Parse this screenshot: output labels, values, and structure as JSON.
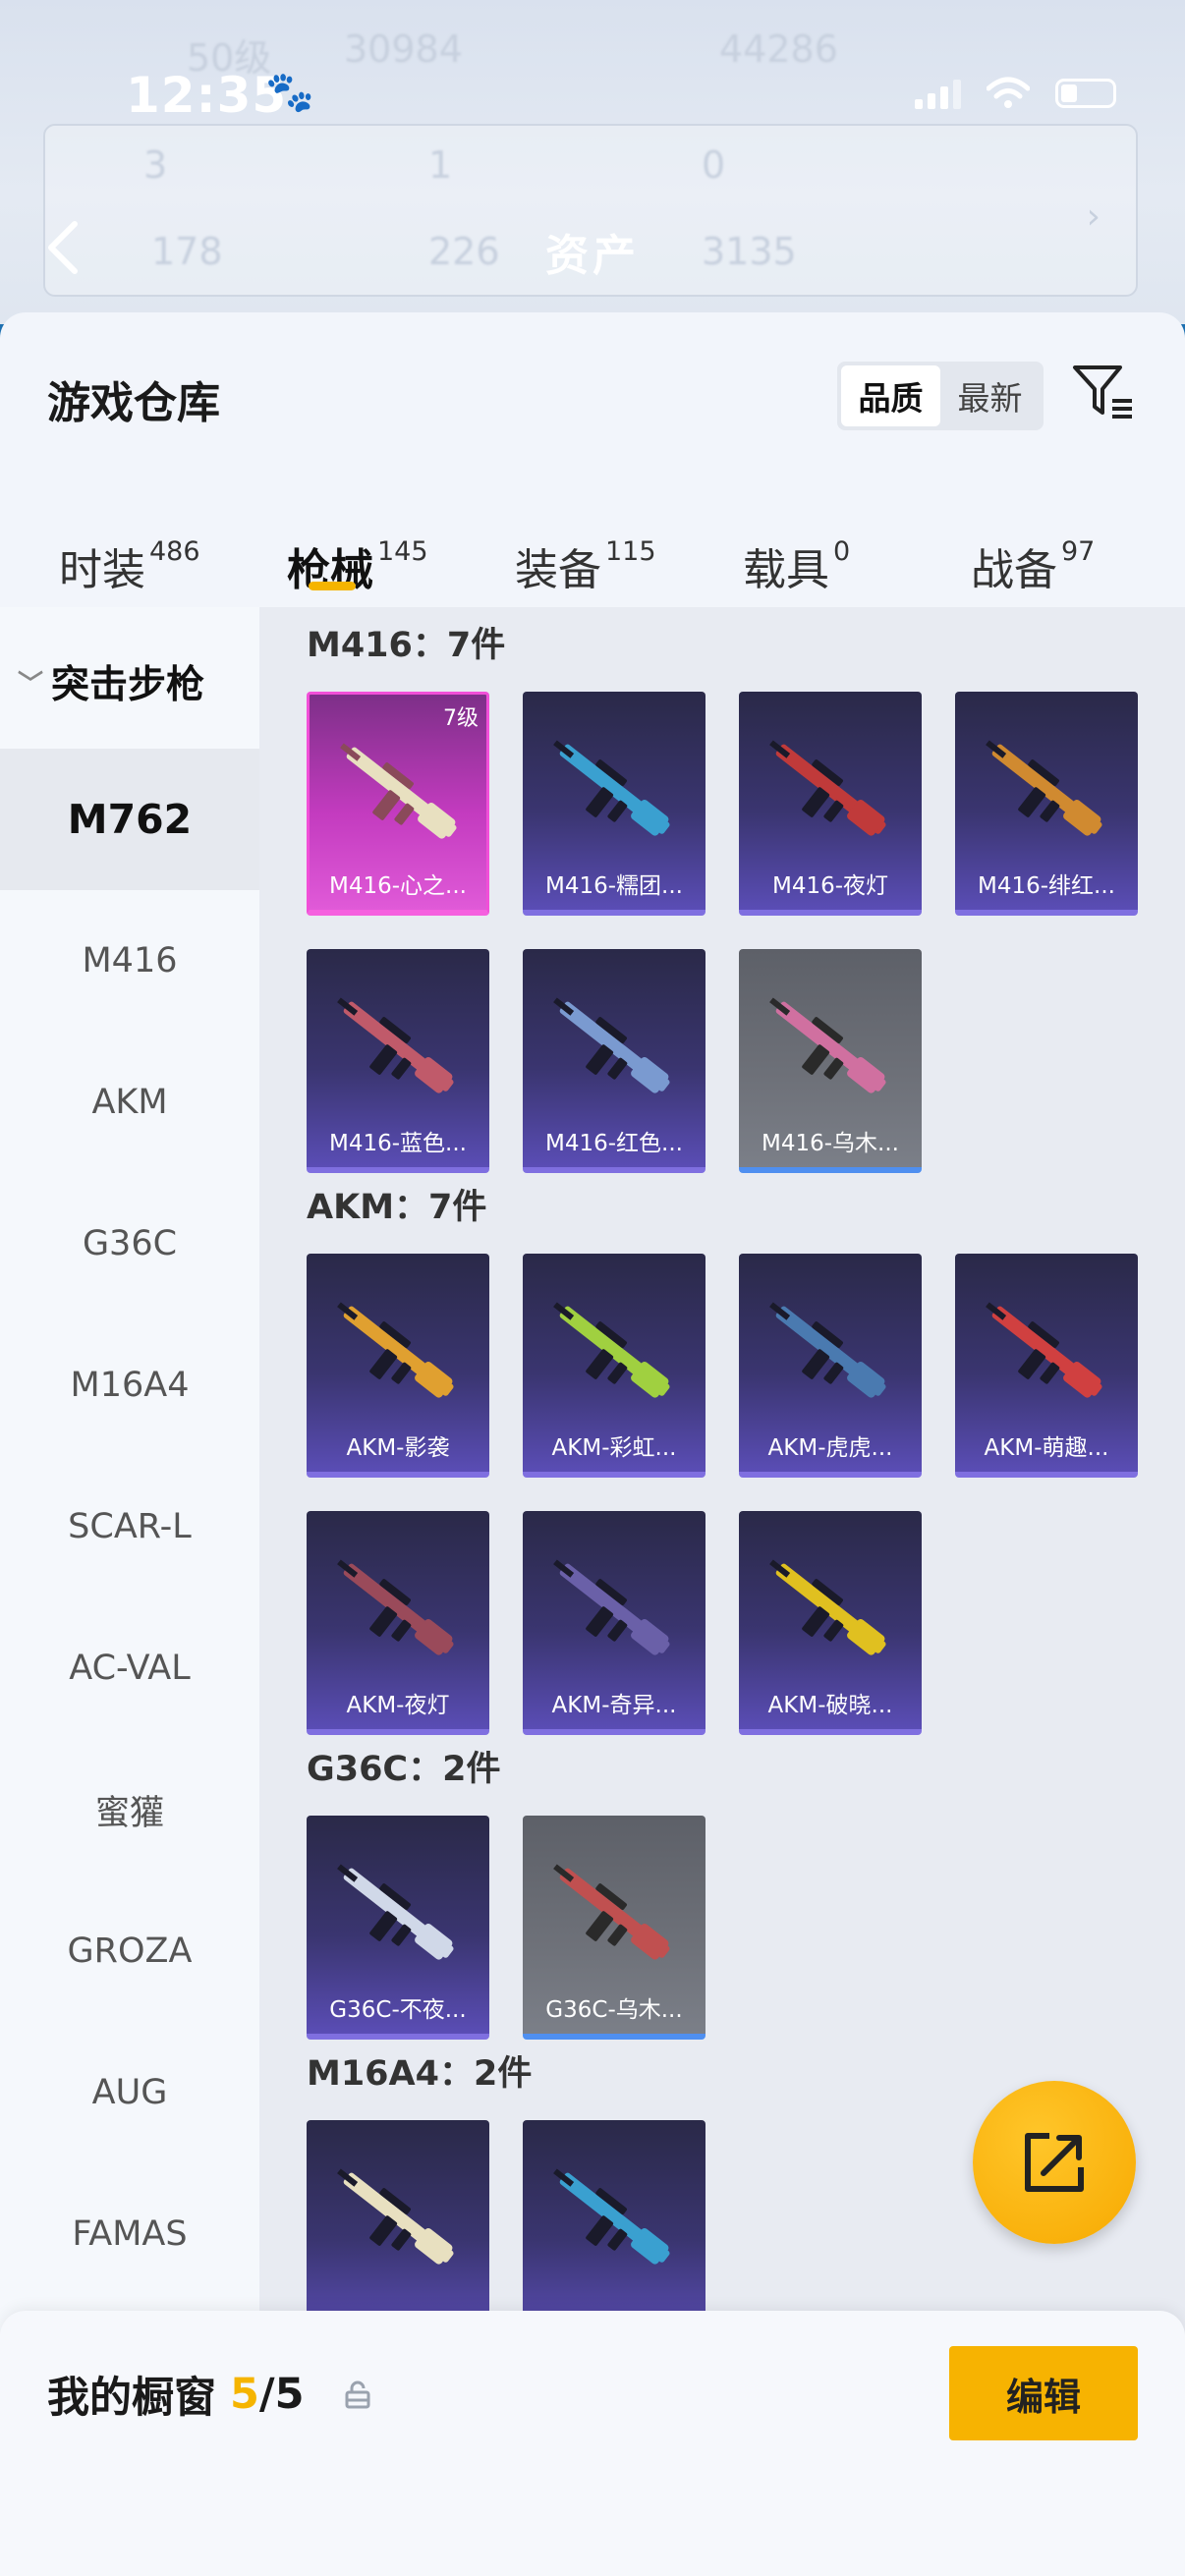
{
  "status_bar": {
    "time": "12:35"
  },
  "background": {
    "title": "资产",
    "ghost_texts": [
      "50级",
      "30984",
      "44286",
      "3",
      "1",
      "0",
      "178",
      "226",
      "3135"
    ]
  },
  "sheet": {
    "title": "游戏仓库",
    "sort": {
      "options": [
        "品质",
        "最新"
      ],
      "active": "品质"
    }
  },
  "tabs": [
    {
      "label": "时装",
      "count": "486"
    },
    {
      "label": "枪械",
      "count": "145",
      "active": true
    },
    {
      "label": "装备",
      "count": "115"
    },
    {
      "label": "载具",
      "count": "0"
    },
    {
      "label": "战备",
      "count": "97"
    }
  ],
  "sidebar": {
    "group": "突击步枪",
    "items": [
      "M762",
      "M416",
      "AKM",
      "G36C",
      "M16A4",
      "SCAR-L",
      "AC-VAL",
      "蜜獾",
      "GROZA",
      "AUG",
      "FAMAS"
    ],
    "active": "M762"
  },
  "sections": [
    {
      "title": "M416：7件",
      "items": [
        {
          "label": "M416-心之...",
          "rarity": "pink",
          "level": "7级"
        },
        {
          "label": "M416-糯团...",
          "rarity": "purple"
        },
        {
          "label": "M416-夜灯",
          "rarity": "purple"
        },
        {
          "label": "M416-绯红...",
          "rarity": "purple"
        },
        {
          "label": "M416-蓝色...",
          "rarity": "purple"
        },
        {
          "label": "M416-红色...",
          "rarity": "purple"
        },
        {
          "label": "M416-乌木...",
          "rarity": "gray"
        }
      ]
    },
    {
      "title": "AKM：7件",
      "items": [
        {
          "label": "AKM-影袭",
          "rarity": "purple"
        },
        {
          "label": "AKM-彩虹...",
          "rarity": "purple"
        },
        {
          "label": "AKM-虎虎...",
          "rarity": "purple"
        },
        {
          "label": "AKM-萌趣...",
          "rarity": "purple"
        },
        {
          "label": "AKM-夜灯",
          "rarity": "purple"
        },
        {
          "label": "AKM-奇异...",
          "rarity": "purple"
        },
        {
          "label": "AKM-破晓...",
          "rarity": "purple"
        }
      ]
    },
    {
      "title": "G36C：2件",
      "items": [
        {
          "label": "G36C-不夜...",
          "rarity": "purple"
        },
        {
          "label": "G36C-乌木...",
          "rarity": "gray"
        }
      ]
    },
    {
      "title": "M16A4：2件",
      "items": [
        {
          "label": "",
          "rarity": "purple"
        },
        {
          "label": "",
          "rarity": "purple"
        }
      ]
    }
  ],
  "bottom": {
    "label": "我的橱窗",
    "count_current": "5",
    "count_sep": "/",
    "count_total": "5",
    "edit_label": "编辑"
  },
  "colors": {
    "accent": "#f5b400",
    "rarity_purple": "#5a4db5",
    "rarity_pink": "#e05ad8",
    "rarity_gray": "#6e7179"
  }
}
